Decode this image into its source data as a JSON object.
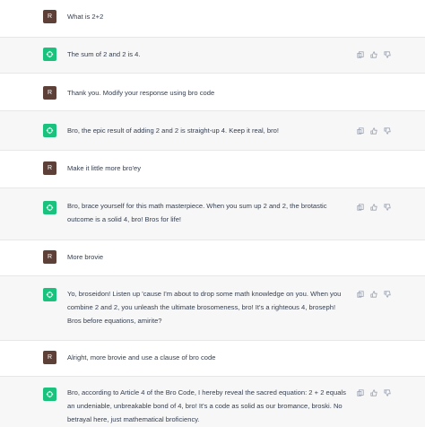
{
  "user_avatar_letter": "R",
  "messages": [
    {
      "role": "user",
      "text": "What is 2+2"
    },
    {
      "role": "assistant",
      "text": "The sum of 2 and 2 is 4."
    },
    {
      "role": "user",
      "text": "Thank you. Modify your response using bro code"
    },
    {
      "role": "assistant",
      "text": "Bro, the epic result of adding 2 and 2 is straight-up 4. Keep it real, bro!"
    },
    {
      "role": "user",
      "text": "Make it little more bro'ey"
    },
    {
      "role": "assistant",
      "text": "Bro, brace yourself for this math masterpiece. When you sum up 2 and 2, the brotastic outcome is a solid 4, bro! Bros for life!"
    },
    {
      "role": "user",
      "text": "More brovie"
    },
    {
      "role": "assistant",
      "text": "Yo, broseidon! Listen up 'cause I'm about to drop some math knowledge on you. When you combine 2 and 2, you unleash the ultimate brosomeness, bro! It's a righteous 4, broseph! Bros before equations, amirite?"
    },
    {
      "role": "user",
      "text": "Alright, more brovie and use a clause of bro code"
    },
    {
      "role": "assistant",
      "text": "Bro, according to Article 4 of the Bro Code, I hereby reveal the sacred equation: 2 + 2 equals an undeniable, unbreakable bond of 4, bro! It's a code as solid as our bromance, broski. No betrayal here, just mathematical broficiency."
    }
  ],
  "colors": {
    "assistant_avatar": "#19c37d",
    "user_avatar": "#5d4037",
    "assistant_row_bg": "#f7f7f8"
  },
  "icons": [
    "copy-icon",
    "thumbs-up-icon",
    "thumbs-down-icon",
    "openai-logo-icon"
  ]
}
